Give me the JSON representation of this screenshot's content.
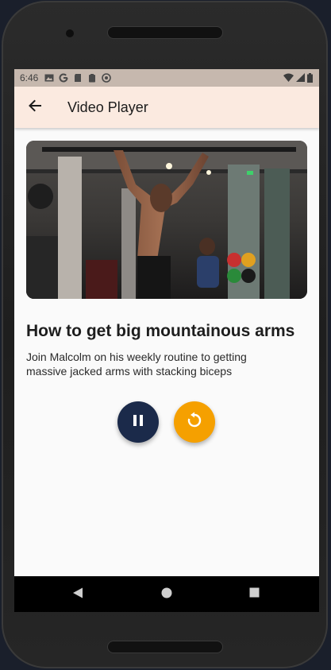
{
  "status_bar": {
    "time": "6:46",
    "icons": [
      "gallery-icon",
      "google-icon",
      "sd-card-icon",
      "clipboard-icon",
      "sync-icon"
    ],
    "right_icons": [
      "wifi-icon",
      "signal-icon",
      "battery-icon"
    ]
  },
  "app_bar": {
    "title": "Video Player",
    "back_icon": "arrow-back-icon",
    "background": "#fbeae0"
  },
  "video": {
    "title": "How to get big mountainous arms",
    "description": "Join Malcolm on his weekly routine to getting massive jacked arms with stacking biceps"
  },
  "controls": {
    "pause": {
      "icon": "pause-icon",
      "color": "#1b2a4a"
    },
    "replay": {
      "icon": "replay-icon",
      "color": "#f5a000"
    }
  },
  "nav_bar": {
    "buttons": [
      "back-triangle-icon",
      "home-circle-icon",
      "recents-square-icon"
    ]
  }
}
